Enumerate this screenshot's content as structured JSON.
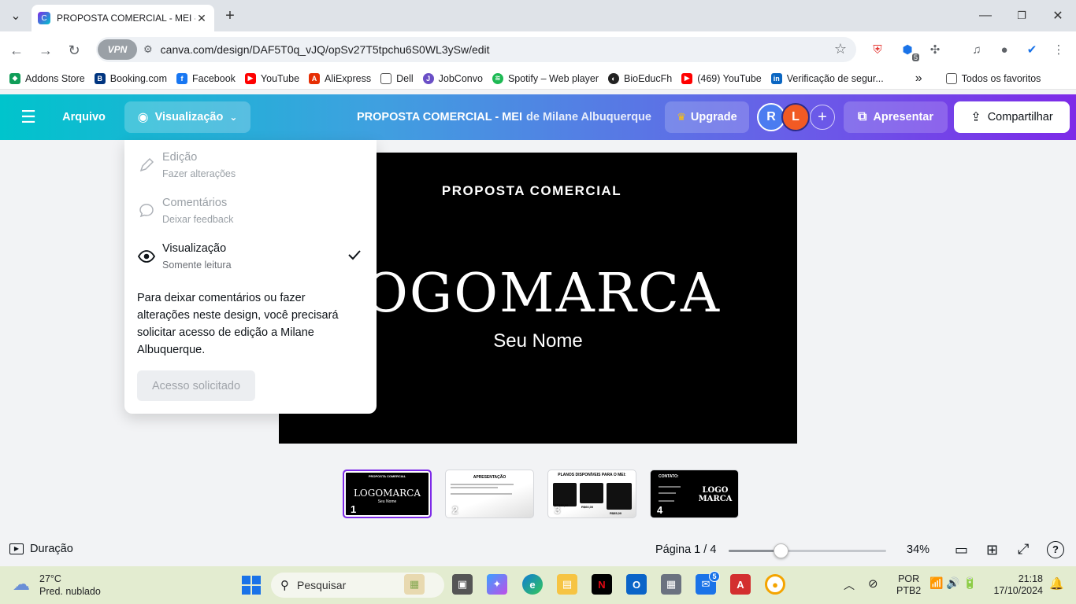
{
  "browser": {
    "tab_title": "PROPOSTA COMERCIAL - MEI - ...",
    "url": "canva.com/design/DAF5T0q_vJQ/opSv27T5tpchu6S0WL3ySw/edit",
    "vpn_label": "VPN",
    "extension_badge": "5"
  },
  "bookmarks": {
    "items": [
      "Addons Store",
      "Booking.com",
      "Facebook",
      "YouTube",
      "AliExpress",
      "Dell",
      "JobConvo",
      "Spotify – Web player",
      "BioEducFh",
      "(469) YouTube",
      "Verificação de segur..."
    ],
    "more": "»",
    "all_favorites": "Todos os favoritos"
  },
  "canva": {
    "file_menu": "Arquivo",
    "view_menu": "Visualização",
    "doc_title": "PROPOSTA COMERCIAL - MEI",
    "doc_by": "de Milane Albuquerque",
    "upgrade": "Upgrade",
    "avatar_r": "R",
    "avatar_l": "L",
    "add": "+",
    "present": "Apresentar",
    "share": "Compartilhar"
  },
  "menu": {
    "items": [
      {
        "title": "Edição",
        "subtitle": "Fazer alterações",
        "icon": "pencil-icon"
      },
      {
        "title": "Comentários",
        "subtitle": "Deixar feedback",
        "icon": "comment-icon"
      },
      {
        "title": "Visualização",
        "subtitle": "Somente leitura",
        "icon": "eye-icon",
        "selected": true
      }
    ],
    "note": "Para deixar comentários ou fazer alterações neste design, você precisará solicitar acesso de edição a Milane Albuquerque.",
    "request_button": "Acesso solicitado"
  },
  "slide": {
    "title": "PROPOSTA COMERCIAL",
    "logo": "LOGOMARCA",
    "name": "Seu Nome"
  },
  "thumbnails": [
    {
      "num": "1",
      "title": "PROPOSTA COMERCIAL",
      "logo": "LOGOMARCA",
      "name": "Seu Nome"
    },
    {
      "num": "2",
      "title": "APRESENTAÇÃO"
    },
    {
      "num": "3",
      "title": "PLANOS DISPONÍVEIS PARA O MEI:",
      "prices": [
        "R$350,00",
        "R$60,00",
        "R$85,00"
      ]
    },
    {
      "num": "4",
      "title": "CONTATO:",
      "logo1": "LOGO",
      "logo2": "MARCA"
    }
  ],
  "bottom": {
    "duration": "Duração",
    "page": "Página 1 / 4",
    "zoom": "34%",
    "zoom_fraction": 0.33
  },
  "taskbar": {
    "temp": "27°C",
    "weather": "Pred. nublado",
    "search": "Pesquisar",
    "mail_badge": "5",
    "lang1": "POR",
    "lang2": "PTB2",
    "time": "21:18",
    "date": "17/10/2024"
  }
}
